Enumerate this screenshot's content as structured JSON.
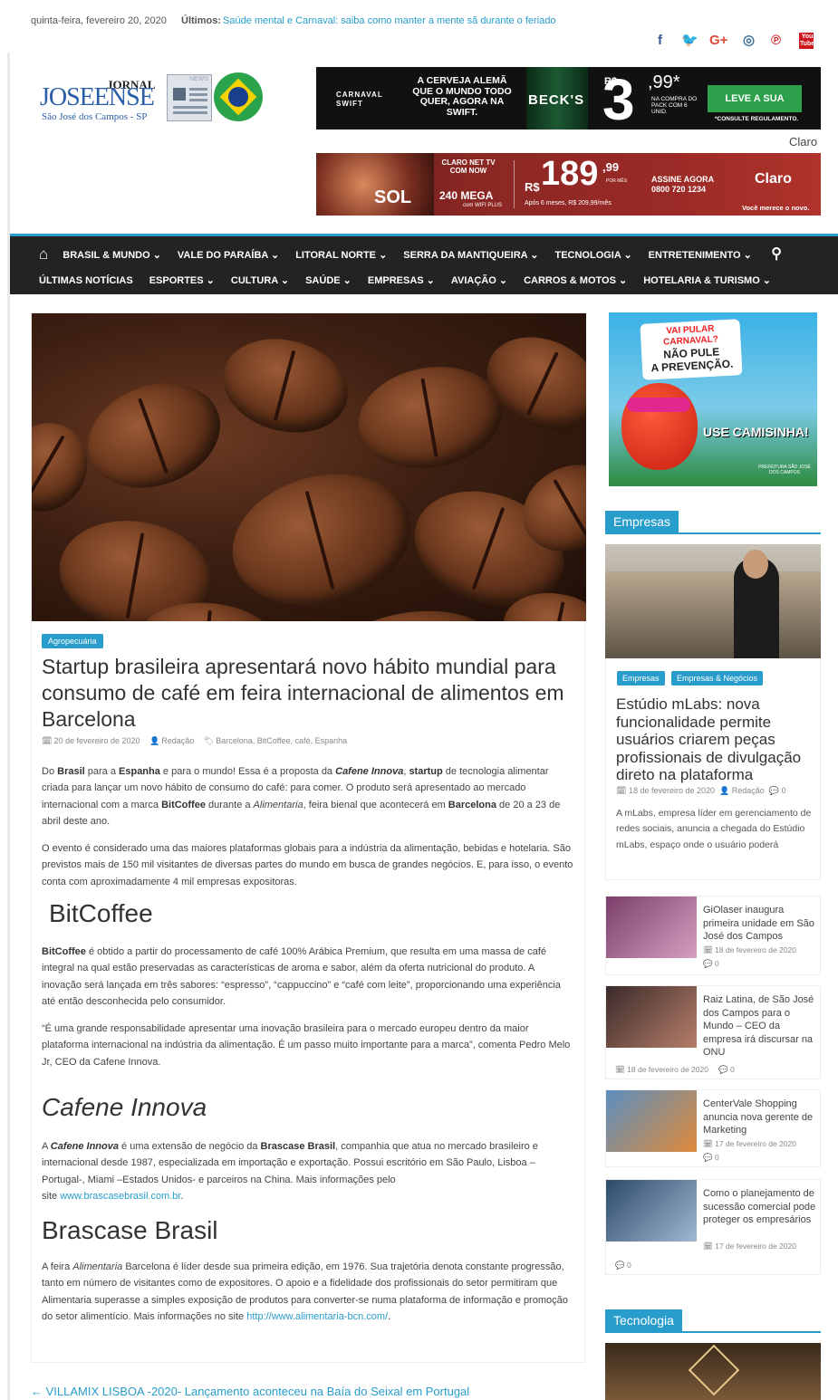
{
  "topbar": {
    "date": "quinta-feira, fevereiro 20, 2020",
    "latest_label": "Últimos:",
    "latest_link": "Saúde mental e Carnaval: saiba como manter a mente sã durante o feriado"
  },
  "social": [
    {
      "name": "facebook-icon",
      "glyph": "f",
      "color": "#3b5998"
    },
    {
      "name": "twitter-icon",
      "glyph": "🐦",
      "color": "#1da1f2"
    },
    {
      "name": "google-plus-icon",
      "glyph": "G+",
      "color": "#dd4b39"
    },
    {
      "name": "instagram-icon",
      "glyph": "◎",
      "color": "#3f729b"
    },
    {
      "name": "pinterest-icon",
      "glyph": "℗",
      "color": "#cb2027"
    },
    {
      "name": "youtube-icon",
      "glyph": "You Tube",
      "color": "#cc181e"
    }
  ],
  "logo": {
    "line1": "JORNAL",
    "line2": "JOSEENSE",
    "line3": "São José dos Campos - SP",
    "news": "NEWS"
  },
  "ad1": {
    "tag": "CARNAVAL SWIFT",
    "headline": "A CERVEJA ALEMÃ QUE O MUNDO TODO QUER, AGORA NA SWIFT.",
    "brand": "BECK'S",
    "price_prefix": "R$",
    "price_int": "3",
    "price_dec": ",99*",
    "price_note": "NA COMPRA DO PACK COM 6 UNID.",
    "cta": "LEVE A SUA",
    "disclaimer": "*CONSULTE REGULAMENTO."
  },
  "ad_label": "Claro",
  "ad2": {
    "promo": "CLARO NET TV COM NOW",
    "speed": "240 MEGA",
    "speed_sub": "com WIFI PLUS",
    "sol": "SOL",
    "currency": "R$",
    "price": "189",
    "cents": ",99",
    "period": "POR MÊS",
    "after": "Após 6 meses, R$ 209,99/mês",
    "cta": "ASSINE AGORA",
    "phone": "0800 720 1234",
    "brand": "Claro",
    "slogan": "Você merece o novo."
  },
  "nav": {
    "row1": [
      "BRASIL & MUNDO ⌄",
      "VALE DO PARAÍBA ⌄",
      "LITORAL NORTE ⌄",
      "SERRA DA MANTIQUEIRA ⌄",
      "TECNOLOGIA ⌄",
      "ENTRETENIMENTO ⌄"
    ],
    "row2": [
      "ÚLTIMAS NOTÍCIAS",
      "ESPORTES ⌄",
      "CULTURA ⌄",
      "SAÚDE ⌄",
      "EMPRESAS ⌄",
      "AVIAÇÃO ⌄",
      "CARROS & MOTOS ⌄",
      "HOTELARIA & TURISMO ⌄"
    ]
  },
  "article": {
    "category": "Agropecuária",
    "title": "Startup brasileira apresentará novo hábito mundial para consumo de café em feira internacional de alimentos em Barcelona",
    "date": "20 de fevereiro de 2020",
    "author": "Redação",
    "tags": "Barcelona, BitCoffee, café, Espanha",
    "p1": "Do <b>Brasil</b> para a <b>Espanha</b> e para o mundo! Essa é a proposta da <b><i>Cafene Innova</i></b>, <b>startup</b> de tecnologia alimentar criada para lançar um novo hábito de consumo do café: para comer. O produto será apresentado ao mercado internacional com a marca <b>BitCoffee</b> durante a <i>Alimentaria</i>, feira bienal que acontecerá em <b>Barcelona</b> de 20 a 23 de abril deste ano.",
    "p2": "O evento é considerado uma das maiores plataformas globais para a indústria da alimentação, bebidas e hotelaria. São previstos mais de 150 mil visitantes de diversas partes do mundo em busca de grandes negócios. E, para isso, o evento conta com aproximadamente 4 mil empresas expositoras.",
    "h_bitcoffee": "BitCoffee",
    "p3": "<b>BitCoffee</b> é obtido a partir do processamento de café 100% Arábica Premium, que resulta em uma massa de café integral na qual estão preservadas as características de aroma e sabor, além da oferta nutricional do produto. A inovação será lançada em três sabores: “espresso”, “cappuccino” e “café com leite”, proporcionando uma experiência até então desconhecida pelo consumidor.",
    "p4": "“É uma grande responsabilidade apresentar uma inovação brasileira para o mercado europeu dentro da maior plataforma internacional na indústria da alimentação. É um passo muito importante para a marca”, comenta Pedro Melo Jr, CEO da Cafene Innova.",
    "h_cafene": "Cafene Innova",
    "p5": "A <b><i>Cafene Innova</i></b> é uma extensão de negócio da <b>Brascase Brasil</b>, companhia que atua no mercado brasileiro e internacional desde 1987, especializada em importação e exportação. Possui escritório em São Paulo, Lisboa – Portugal-, Miami –Estados Unidos- e parceiros na China. Mais informações pelo<br>site <a data-name='brascase-link' data-interactable='true'>www.brascasebrasil.com.br</a>.",
    "h_brascase": "Brascase Brasil",
    "p6": "A feira <i>Alimentaria</i> Barcelona é líder desde sua primeira edição, em 1976. Sua trajetória denota constante progressão, tanto em número de visitantes como de expositores. O apoio e a fidelidade dos profissionais do setor permitiram que Alimentaria superasse a simples exposição de produtos para converter-se numa plataforma de informação e promoção do setor alimentício. Mais informações no site <a data-name='alimentaria-link' data-interactable='true'>http://www.alimentaria-bcn.com/</a>.",
    "prev": "← VILLAMIX LISBOA -2020- Lançamento aconteceu na Baía do Seixal em Portugal"
  },
  "sidead": {
    "line1": "VAI PULAR CARNAVAL?",
    "line2": "NÃO PULE",
    "line3": "A PREVENÇÃO.",
    "cta": "USE CAMISINHA!",
    "org": "PREFEITURA SÃO JOSÉ DOS CAMPOS"
  },
  "empresas": {
    "section": "Empresas",
    "tags": [
      "Empresas",
      "Empresas & Negócios"
    ],
    "featured": {
      "title": "Estúdio mLabs: nova funcionalidade permite usuários criarem peças profissionais de divulgação direto na plataforma",
      "date": "18 de fevereiro de 2020",
      "author": "Redação",
      "comments": "0",
      "excerpt": "A mLabs, empresa líder em gerenciamento de redes sociais, anuncia a chegada do Estúdio mLabs, espaço onde o usuário poderá"
    },
    "items": [
      {
        "title": "GiOlaser inaugura primeira unidade em São José dos Campos",
        "date": "18 de fevereiro de 2020",
        "comments": "0"
      },
      {
        "title": "Raiz Latina, de São José dos Campos para o Mundo – CEO da empresa irá discursar na ONU",
        "date": "18 de fevereiro de 2020",
        "comments": "0"
      },
      {
        "title": "CenterVale Shopping anuncia nova gerente de Marketing",
        "date": "17 de fevereiro de 2020",
        "comments": "0"
      },
      {
        "title": "Como o planejamento de sucessão comercial pode proteger os empresários",
        "date": "17 de fevereiro de 2020",
        "comments": "0"
      }
    ]
  },
  "tecnologia": {
    "section": "Tecnologia"
  },
  "icons": {
    "calendar": "🗓",
    "user": "👤",
    "tag": "🏷",
    "comment": "💬",
    "home": "⌂",
    "search": "⚲"
  }
}
